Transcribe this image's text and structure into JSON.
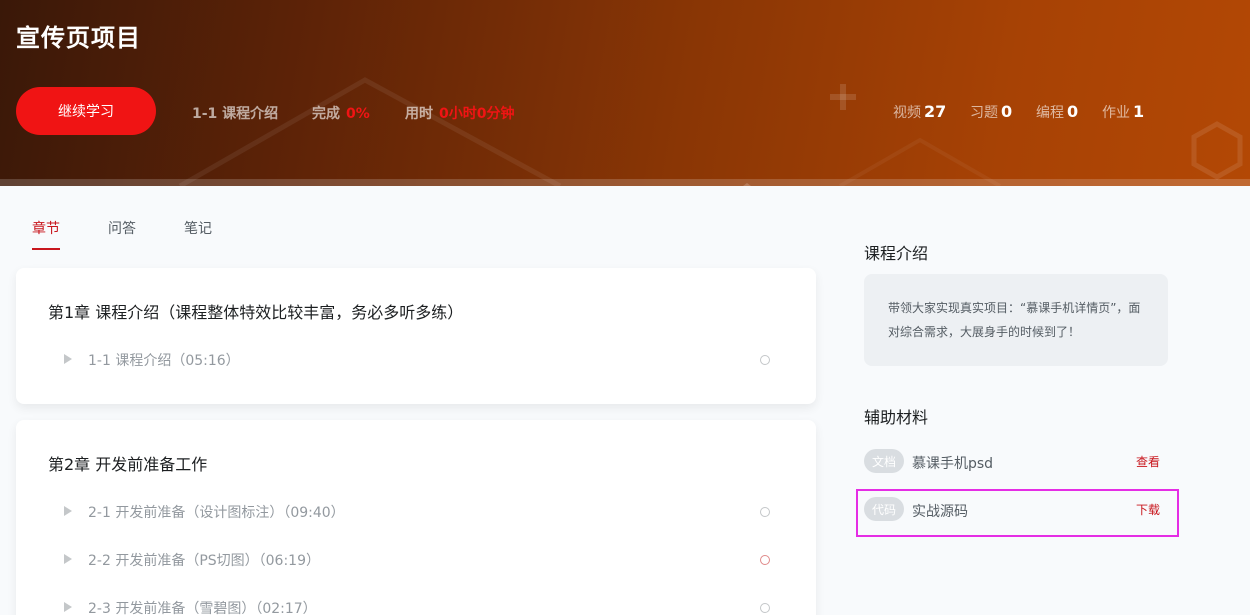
{
  "header": {
    "title": "宣传页项目",
    "continue_label": "继续学习",
    "current_lesson": "1-1 课程介绍",
    "progress_label": "完成",
    "progress_value": "0%",
    "time_label": "用时",
    "time_value": "0小时0分钟",
    "counts": [
      {
        "label": "视频",
        "value": "27"
      },
      {
        "label": "习题",
        "value": "0"
      },
      {
        "label": "编程",
        "value": "0"
      },
      {
        "label": "作业",
        "value": "1"
      }
    ]
  },
  "tabs": [
    {
      "label": "章节",
      "active": true
    },
    {
      "label": "问答",
      "active": false
    },
    {
      "label": "笔记",
      "active": false
    }
  ],
  "chapters": [
    {
      "title": "第1章 课程介绍（课程整体特效比较丰富，务必多听多练）",
      "lessons": [
        {
          "label": "1-1 课程介绍（05:16）",
          "status": "not-started"
        }
      ]
    },
    {
      "title": "第2章 开发前准备工作",
      "lessons": [
        {
          "label": "2-1 开发前准备（设计图标注）（09:40）",
          "status": "not-started"
        },
        {
          "label": "2-2 开发前准备（PS切图）（06:19）",
          "status": "in-progress"
        },
        {
          "label": "2-3 开发前准备（雪碧图）（02:17）",
          "status": "not-started"
        }
      ]
    }
  ],
  "sidebar": {
    "intro_heading": "课程介绍",
    "intro_text": "带领大家实现真实项目：“慕课手机详情页”，面对综合需求，大展身手的时候到了！",
    "materials_heading": "辅助材料",
    "materials": [
      {
        "tag": "文档",
        "name": "慕课手机psd",
        "action": "查看"
      },
      {
        "tag": "代码",
        "name": "实战源码",
        "action": "下载"
      }
    ]
  },
  "colors": {
    "accent": "#f01414",
    "tab_active": "#c8161d",
    "highlight": "#e52de5"
  }
}
